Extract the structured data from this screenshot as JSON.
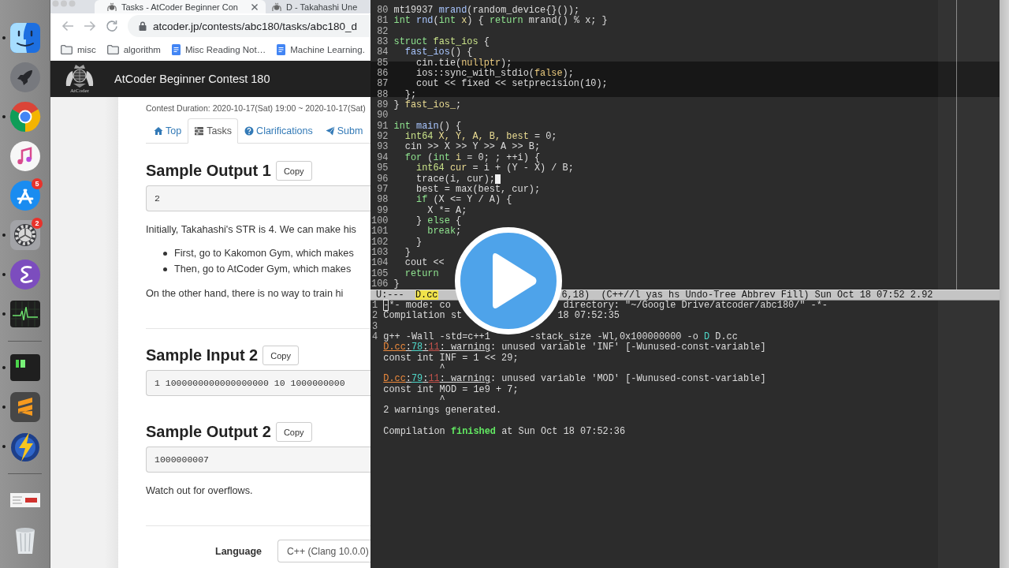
{
  "dock": {
    "items": [
      {
        "kind": "face",
        "running": true
      },
      {
        "kind": "rocket",
        "running": false
      },
      {
        "kind": "color_wheel",
        "running": true
      },
      {
        "kind": "music_note",
        "running": false
      },
      {
        "kind": "letter_a",
        "running": false,
        "badge": "5"
      },
      {
        "kind": "gear",
        "running": true,
        "badge": "2"
      },
      {
        "kind": "swirl",
        "running": true
      },
      {
        "kind": "pulse",
        "running": true
      },
      {
        "kind": "separator"
      },
      {
        "kind": "terminal",
        "running": true
      },
      {
        "kind": "stripes",
        "running": true
      },
      {
        "kind": "lightning",
        "running": true
      },
      {
        "kind": "separator"
      },
      {
        "kind": "thumbnail",
        "running": false
      },
      {
        "kind": "trash",
        "running": false
      }
    ]
  },
  "browser": {
    "tabs": [
      {
        "title": "Tasks - AtCoder Beginner Con",
        "selected": true
      },
      {
        "title": "D - Takahashi Une",
        "selected": false
      }
    ],
    "address": "atcoder.jp/contests/abc180/tasks/abc180_d",
    "bookmarks": [
      {
        "kind": "folder",
        "label": "misc"
      },
      {
        "kind": "folder",
        "label": "algorithm"
      },
      {
        "kind": "document",
        "label": "Misc Reading Not…"
      },
      {
        "kind": "document",
        "label": "Machine Learning."
      }
    ],
    "site_header": {
      "logo_text": "AtCoder",
      "title": "AtCoder Beginner Contest 180"
    },
    "contest_duration": "Contest Duration: 2020-10-17(Sat) 19:00 ~ 2020-10-17(Sat)",
    "nav": [
      {
        "kind": "home",
        "label": "Top",
        "selected": false
      },
      {
        "kind": "tasks",
        "label": "Tasks",
        "selected": true
      },
      {
        "kind": "question",
        "label": "Clarifications",
        "selected": false
      },
      {
        "kind": "send",
        "label": "Subm",
        "selected": false
      }
    ],
    "blocks": [
      {
        "kind": "heading",
        "text": "Sample Output 1",
        "button": "Copy"
      },
      {
        "kind": "sample",
        "text": "2"
      },
      {
        "kind": "paragraph",
        "text": "Initially, Takahashi's STR is 4. We can make his"
      },
      {
        "kind": "bullets",
        "items": [
          "First, go to Kakomon Gym, which makes",
          "Then, go to AtCoder Gym, which makes"
        ]
      },
      {
        "kind": "paragraph",
        "text": "On the other hand, there is no way to train hi"
      },
      {
        "kind": "rule"
      },
      {
        "kind": "heading",
        "text": "Sample Input 2",
        "button": "Copy"
      },
      {
        "kind": "sample",
        "text": "1 1000000000000000000 10 1000000000"
      },
      {
        "kind": "heading",
        "text": "Sample Output 2",
        "button": "Copy"
      },
      {
        "kind": "sample",
        "text": "1000000007"
      },
      {
        "kind": "paragraph",
        "text": "Watch out for overflows."
      },
      {
        "kind": "rule"
      },
      {
        "kind": "language",
        "label": "Language",
        "value": "C++ (Clang 10.0.0)"
      }
    ]
  },
  "editor": {
    "lines": [
      {
        "number": "80",
        "cursor": false,
        "tokens": [
          {
            "text": "mt19937 ",
            "kind": "plain"
          },
          {
            "text": "mrand",
            "kind": "function"
          },
          {
            "text": "(random_device{}());",
            "kind": "plain"
          }
        ]
      },
      {
        "number": "81",
        "cursor": false,
        "tokens": [
          {
            "text": "int",
            "kind": "keyword"
          },
          {
            "text": " rnd",
            "kind": "function"
          },
          {
            "text": "(",
            "kind": "plain"
          },
          {
            "text": "int",
            "kind": "keyword"
          },
          {
            "text": " x",
            "kind": "variable"
          },
          {
            "text": ") { ",
            "kind": "plain"
          },
          {
            "text": "return",
            "kind": "keyword"
          },
          {
            "text": " mrand() % x; }",
            "kind": "plain"
          }
        ]
      },
      {
        "number": "82",
        "cursor": false
      },
      {
        "number": "83",
        "cursor": false,
        "tokens": [
          {
            "text": "struct",
            "kind": "keyword"
          },
          {
            "text": " fast_ios",
            "kind": "type"
          },
          {
            "text": " {",
            "kind": "plain"
          }
        ]
      },
      {
        "number": "84",
        "cursor": false,
        "tokens": [
          {
            "text": "  fast_ios",
            "kind": "function"
          },
          {
            "text": "() {",
            "kind": "plain"
          }
        ]
      },
      {
        "number": "85",
        "cursor": false,
        "tokens": [
          {
            "text": "    cin.tie(",
            "kind": "plain"
          },
          {
            "text": "nullptr",
            "kind": "constant"
          },
          {
            "text": ");",
            "kind": "plain"
          }
        ]
      },
      {
        "number": "86",
        "cursor": false,
        "tokens": [
          {
            "text": "    ios::sync_with_stdio(",
            "kind": "plain"
          },
          {
            "text": "false",
            "kind": "constant"
          },
          {
            "text": ");",
            "kind": "plain"
          }
        ]
      },
      {
        "number": "87",
        "cursor": false,
        "tokens": [
          {
            "text": "    cout << fixed << setprecision(10);",
            "kind": "plain"
          }
        ]
      },
      {
        "number": "88",
        "cursor": false,
        "tokens": [
          {
            "text": "  };",
            "kind": "plain"
          }
        ]
      },
      {
        "number": "89",
        "cursor": false,
        "tokens": [
          {
            "text": "} ",
            "kind": "plain"
          },
          {
            "text": "fast_ios_",
            "kind": "variable"
          },
          {
            "text": ";",
            "kind": "plain"
          }
        ]
      },
      {
        "number": "90",
        "cursor": false
      },
      {
        "number": "91",
        "cursor": false,
        "tokens": [
          {
            "text": "int",
            "kind": "keyword"
          },
          {
            "text": " main",
            "kind": "function"
          },
          {
            "text": "() {",
            "kind": "plain"
          }
        ]
      },
      {
        "number": "92",
        "cursor": false,
        "tokens": [
          {
            "text": "  int64",
            "kind": "type"
          },
          {
            "text": " X, Y, A, B, best",
            "kind": "variable"
          },
          {
            "text": " = 0;",
            "kind": "plain"
          }
        ]
      },
      {
        "number": "93",
        "cursor": false,
        "tokens": [
          {
            "text": "  cin >> X >> Y >> A >> B;",
            "kind": "plain"
          }
        ]
      },
      {
        "number": "94",
        "cursor": false,
        "tokens": [
          {
            "text": "  for",
            "kind": "keyword"
          },
          {
            "text": " (",
            "kind": "plain"
          },
          {
            "text": "int",
            "kind": "keyword"
          },
          {
            "text": " i",
            "kind": "variable"
          },
          {
            "text": " = 0; ; ++i) {",
            "kind": "plain"
          }
        ]
      },
      {
        "number": "95",
        "cursor": false,
        "tokens": [
          {
            "text": "    int64",
            "kind": "type"
          },
          {
            "text": " cur",
            "kind": "variable"
          },
          {
            "text": " = i + (Y - X) / B;",
            "kind": "plain"
          }
        ]
      },
      {
        "number": "96",
        "cursor": true,
        "tokens": [
          {
            "text": "    trace(i, cur);",
            "kind": "plain"
          }
        ]
      },
      {
        "number": "97",
        "cursor": false,
        "tokens": [
          {
            "text": "    best = max(best, cur);",
            "kind": "plain"
          }
        ]
      },
      {
        "number": "98",
        "cursor": false,
        "tokens": [
          {
            "text": "    if",
            "kind": "keyword"
          },
          {
            "text": " (X <= Y / A) {",
            "kind": "plain"
          }
        ]
      },
      {
        "number": "99",
        "cursor": false,
        "tokens": [
          {
            "text": "      X *= A;",
            "kind": "plain"
          }
        ]
      },
      {
        "number": "100",
        "cursor": false,
        "tokens": [
          {
            "text": "    } ",
            "kind": "plain"
          },
          {
            "text": "else",
            "kind": "keyword"
          },
          {
            "text": " {",
            "kind": "plain"
          }
        ]
      },
      {
        "number": "101",
        "cursor": false,
        "tokens": [
          {
            "text": "      break",
            "kind": "keyword"
          },
          {
            "text": ";",
            "kind": "plain"
          }
        ]
      },
      {
        "number": "102",
        "cursor": false,
        "tokens": [
          {
            "text": "    }",
            "kind": "plain"
          }
        ]
      },
      {
        "number": "103",
        "cursor": false,
        "tokens": [
          {
            "text": "  }",
            "kind": "plain"
          }
        ]
      },
      {
        "number": "104",
        "cursor": false,
        "tokens": [
          {
            "text": "  cout <<",
            "kind": "plain"
          }
        ]
      },
      {
        "number": "105",
        "cursor": false,
        "tokens": [
          {
            "text": "  return",
            "kind": "keyword"
          }
        ]
      },
      {
        "number": "106",
        "cursor": false,
        "tokens": [
          {
            "text": "}",
            "kind": "plain"
          }
        ]
      }
    ]
  },
  "mode_line": {
    "status": "U:---",
    "buffer": "D.cc",
    "info": "6,18)  (C++//l yas hs Undo-Tree Abbrev Fill) Sun Oct 18 07:52 2.92"
  },
  "compilation": {
    "lines": [
      {
        "number": "1",
        "cursor": true,
        "runs": [
          [
            {
              "text": "-*- mode: co",
              "kind": "plain"
            }
          ],
          [
            {
              "text": "directory: \"~/Google Drive/atcoder/abc180/\" -*-",
              "kind": "plain"
            }
          ]
        ]
      },
      {
        "number": "2",
        "cursor": false,
        "runs": [
          [
            {
              "text": "Compilation st",
              "kind": "plain"
            }
          ],
          [
            {
              "text": "18 07:52:35",
              "kind": "plain"
            }
          ]
        ]
      },
      {
        "number": "3",
        "cursor": false
      },
      {
        "number": "4",
        "cursor": false,
        "runs": [
          [
            {
              "text": "g++ -Wall -std=c++1",
              "kind": "plain"
            }
          ],
          [
            {
              "text": "-stack_size -Wl,0x100000000 -o ",
              "kind": "plain"
            },
            {
              "text": "D",
              "kind": "target"
            },
            {
              "text": " D.cc",
              "kind": "plain"
            }
          ]
        ]
      },
      {
        "cursor": false,
        "runs": [
          [
            {
              "text": "D.cc",
              "kind": "file"
            },
            {
              "text": ":",
              "kind": "link"
            },
            {
              "text": "78",
              "kind": "line_no"
            },
            {
              "text": ":",
              "kind": "link"
            },
            {
              "text": "11",
              "kind": "column"
            },
            {
              "text": ": warning",
              "kind": "link"
            },
            {
              "text": ": unused variable 'INF' [-Wunused-const-variable]",
              "kind": "plain"
            }
          ]
        ]
      },
      {
        "cursor": false,
        "runs": [
          [
            {
              "text": "const int INF = 1 << 29;",
              "kind": "plain"
            }
          ]
        ]
      },
      {
        "cursor": false,
        "runs": [
          [
            {
              "text": "          ^",
              "kind": "plain"
            }
          ]
        ]
      },
      {
        "cursor": false,
        "runs": [
          [
            {
              "text": "D.cc",
              "kind": "file"
            },
            {
              "text": ":",
              "kind": "link"
            },
            {
              "text": "79",
              "kind": "line_no"
            },
            {
              "text": ":",
              "kind": "link"
            },
            {
              "text": "11",
              "kind": "column"
            },
            {
              "text": ": warning",
              "kind": "link"
            },
            {
              "text": ": unused variable 'MOD' [-Wunused-const-variable]",
              "kind": "plain"
            }
          ]
        ]
      },
      {
        "cursor": false,
        "runs": [
          [
            {
              "text": "const int MOD = 1e9 + 7;",
              "kind": "plain"
            }
          ]
        ]
      },
      {
        "cursor": false,
        "runs": [
          [
            {
              "text": "          ^",
              "kind": "plain"
            }
          ]
        ]
      },
      {
        "cursor": false,
        "runs": [
          [
            {
              "text": "2 warnings generated.",
              "kind": "plain"
            }
          ]
        ]
      },
      {
        "cursor": false
      },
      {
        "cursor": false,
        "runs": [
          [
            {
              "text": "Compilation ",
              "kind": "plain"
            },
            {
              "text": "finished",
              "kind": "success"
            },
            {
              "text": " at Sun Oct 18 07:52:36",
              "kind": "plain"
            }
          ]
        ]
      }
    ]
  },
  "player": {
    "play_button": true
  }
}
